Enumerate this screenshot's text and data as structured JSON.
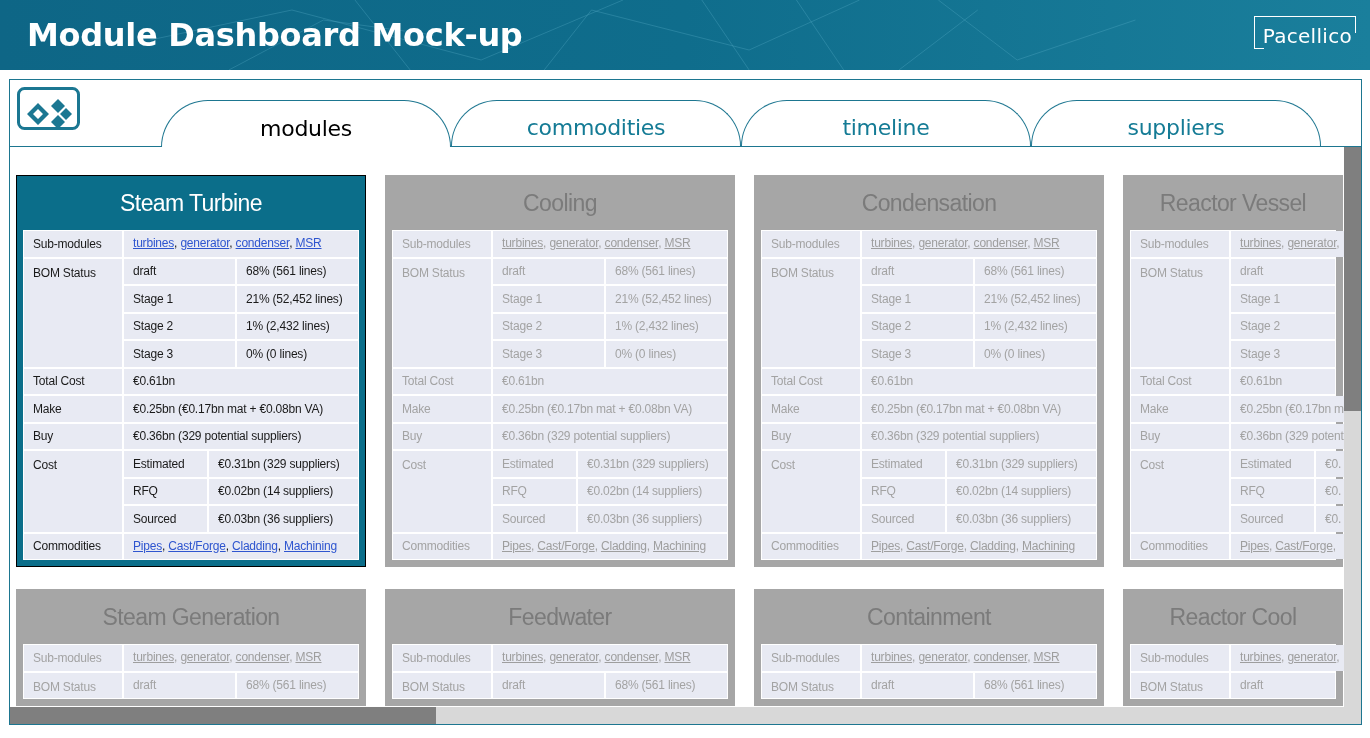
{
  "header": {
    "title": "Module Dashboard Mock-up",
    "brand": "Pacellico"
  },
  "tabs": [
    {
      "label": "modules",
      "selected": true
    },
    {
      "label": "commodities",
      "selected": false
    },
    {
      "label": "timeline",
      "selected": false
    },
    {
      "label": "suppliers",
      "selected": false
    }
  ],
  "cards": [
    {
      "title": "Steam Turbine",
      "selected": true,
      "rows": [
        {
          "kind": "links",
          "label": "Sub-modules",
          "links": [
            "turbines",
            "generator",
            "condenser",
            "MSR"
          ],
          "separator": ", "
        },
        {
          "kind": "status",
          "label": "BOM Status",
          "items": [
            {
              "name": "draft",
              "value": "68% (561 lines)"
            },
            {
              "name": "Stage 1",
              "value": "21% (52,452 lines)"
            },
            {
              "name": "Stage 2",
              "value": "1% (2,432 lines)"
            },
            {
              "name": "Stage 3",
              "value": "0% (0 lines)"
            }
          ]
        },
        {
          "kind": "text",
          "label": "Total Cost",
          "value": "€0.61bn"
        },
        {
          "kind": "text",
          "label": "Make",
          "value": "€0.25bn (€0.17bn mat + €0.08bn VA)"
        },
        {
          "kind": "text",
          "label": "Buy",
          "value": "€0.36bn (329 potential suppliers)"
        },
        {
          "kind": "cost",
          "label": "Cost",
          "items": [
            {
              "name": "Estimated",
              "value": "€0.31bn (329 suppliers)"
            },
            {
              "name": "RFQ",
              "value": "€0.02bn (14 suppliers)"
            },
            {
              "name": "Sourced",
              "value": "€0.03bn (36 suppliers)"
            }
          ]
        },
        {
          "kind": "links",
          "label": "Commodities",
          "links": [
            "Pipes",
            "Cast/Forge",
            "Cladding",
            "Machining"
          ],
          "separator": ", "
        }
      ]
    },
    {
      "title": "Cooling",
      "selected": false,
      "rows": [
        {
          "kind": "links",
          "label": "Sub-modules",
          "links": [
            "turbines",
            "generator",
            "condenser",
            "MSR"
          ],
          "separator": ", "
        },
        {
          "kind": "status",
          "label": "BOM Status",
          "items": [
            {
              "name": "draft",
              "value": "68% (561 lines)"
            },
            {
              "name": "Stage 1",
              "value": "21% (52,452 lines)"
            },
            {
              "name": "Stage 2",
              "value": "1% (2,432 lines)"
            },
            {
              "name": "Stage 3",
              "value": "0% (0 lines)"
            }
          ]
        },
        {
          "kind": "text",
          "label": "Total Cost",
          "value": "€0.61bn"
        },
        {
          "kind": "text",
          "label": "Make",
          "value": "€0.25bn (€0.17bn mat + €0.08bn VA)"
        },
        {
          "kind": "text",
          "label": "Buy",
          "value": "€0.36bn (329 potential suppliers)"
        },
        {
          "kind": "cost",
          "label": "Cost",
          "items": [
            {
              "name": "Estimated",
              "value": "€0.31bn (329 suppliers)"
            },
            {
              "name": "RFQ",
              "value": "€0.02bn (14 suppliers)"
            },
            {
              "name": "Sourced",
              "value": "€0.03bn (36 suppliers)"
            }
          ]
        },
        {
          "kind": "links",
          "label": "Commodities",
          "links": [
            "Pipes",
            "Cast/Forge",
            "Cladding",
            "Machining"
          ],
          "separator": ", "
        }
      ]
    },
    {
      "title": "Condensation",
      "selected": false,
      "rows": [
        {
          "kind": "links",
          "label": "Sub-modules",
          "links": [
            "turbines",
            "generator",
            "condenser",
            "MSR"
          ],
          "separator": ", "
        },
        {
          "kind": "status",
          "label": "BOM Status",
          "items": [
            {
              "name": "draft",
              "value": "68% (561 lines)"
            },
            {
              "name": "Stage 1",
              "value": "21% (52,452 lines)"
            },
            {
              "name": "Stage 2",
              "value": "1% (2,432 lines)"
            },
            {
              "name": "Stage 3",
              "value": "0% (0 lines)"
            }
          ]
        },
        {
          "kind": "text",
          "label": "Total Cost",
          "value": "€0.61bn"
        },
        {
          "kind": "text",
          "label": "Make",
          "value": "€0.25bn (€0.17bn mat + €0.08bn VA)"
        },
        {
          "kind": "text",
          "label": "Buy",
          "value": "€0.36bn (329 potential suppliers)"
        },
        {
          "kind": "cost",
          "label": "Cost",
          "items": [
            {
              "name": "Estimated",
              "value": "€0.31bn (329 suppliers)"
            },
            {
              "name": "RFQ",
              "value": "€0.02bn (14 suppliers)"
            },
            {
              "name": "Sourced",
              "value": "€0.03bn (36 suppliers)"
            }
          ]
        },
        {
          "kind": "links",
          "label": "Commodities",
          "links": [
            "Pipes",
            "Cast/Forge",
            "Cladding",
            "Machining"
          ],
          "separator": ", "
        }
      ]
    },
    {
      "title": "Reactor Vessel",
      "selected": false,
      "rows": [
        {
          "kind": "links",
          "label": "Sub-modules",
          "links": [
            "turbines",
            "generator"
          ],
          "separator": ", ",
          "trailing": ","
        },
        {
          "kind": "status",
          "label": "BOM Status",
          "items": [
            {
              "name": "draft"
            },
            {
              "name": "Stage 1"
            },
            {
              "name": "Stage 2"
            },
            {
              "name": "Stage 3"
            }
          ]
        },
        {
          "kind": "text",
          "label": "Total Cost",
          "value": "€0.61bn"
        },
        {
          "kind": "text",
          "label": "Make",
          "value": "€0.25bn (€0.17bn m"
        },
        {
          "kind": "text",
          "label": "Buy",
          "value": "€0.36bn (329 potent"
        },
        {
          "kind": "cost",
          "label": "Cost",
          "items": [
            {
              "name": "Estimated",
              "value": "€0."
            },
            {
              "name": "RFQ",
              "value": "€0."
            },
            {
              "name": "Sourced",
              "value": "€0."
            }
          ]
        },
        {
          "kind": "links",
          "label": "Commodities",
          "links": [
            "Pipes",
            "Cast/Forge"
          ],
          "separator": ", ",
          "trailing": ","
        }
      ]
    },
    {
      "title": "Steam Generation",
      "selected": false,
      "rows": [
        {
          "kind": "links",
          "label": "Sub-modules",
          "links": [
            "turbines",
            "generator",
            "condenser",
            "MSR"
          ],
          "separator": ", "
        },
        {
          "kind": "status",
          "label": "BOM Status",
          "items": [
            {
              "name": "draft",
              "value": "68% (561 lines)"
            }
          ]
        }
      ]
    },
    {
      "title": "Feedwater",
      "selected": false,
      "rows": [
        {
          "kind": "links",
          "label": "Sub-modules",
          "links": [
            "turbines",
            "generator",
            "condenser",
            "MSR"
          ],
          "separator": ", "
        },
        {
          "kind": "status",
          "label": "BOM Status",
          "items": [
            {
              "name": "draft",
              "value": "68% (561 lines)"
            }
          ]
        }
      ]
    },
    {
      "title": "Containment",
      "selected": false,
      "rows": [
        {
          "kind": "links",
          "label": "Sub-modules",
          "links": [
            "turbines",
            "generator",
            "condenser",
            "MSR"
          ],
          "separator": ", "
        },
        {
          "kind": "status",
          "label": "BOM Status",
          "items": [
            {
              "name": "draft",
              "value": "68% (561 lines)"
            }
          ]
        }
      ]
    },
    {
      "title": "Reactor Cool",
      "selected": false,
      "rows": [
        {
          "kind": "links",
          "label": "Sub-modules",
          "links": [
            "turbines",
            "generator"
          ],
          "separator": ", ",
          "trailing": ","
        },
        {
          "kind": "status",
          "label": "BOM Status",
          "items": [
            {
              "name": "draft"
            }
          ]
        }
      ]
    }
  ]
}
